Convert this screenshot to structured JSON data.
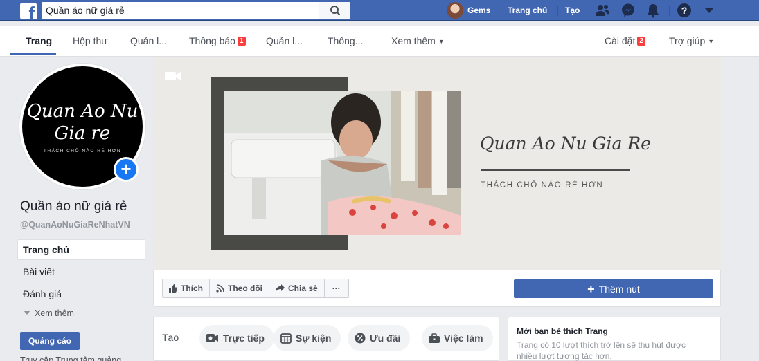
{
  "topbar": {
    "search_value": "Quần áo nữ giá rẻ",
    "user_name": "Gems",
    "home_link": "Trang chủ",
    "create_link": "Tạo",
    "logo_letter": "f"
  },
  "pagenav": {
    "items": [
      "Trang",
      "Hộp thư",
      "Quản l...",
      "Thông báo",
      "Quản l...",
      "Thông...",
      "Xem thêm"
    ],
    "notification_count": "1",
    "settings_label": "Cài đặt",
    "settings_count": "2",
    "help_label": "Trợ giúp"
  },
  "profile": {
    "script_line1": "Quan Ao Nu",
    "script_line2": "Gia re",
    "tagline": "THÁCH CHỖ NÀO RẺ HƠN",
    "name": "Quần áo nữ giá rẻ",
    "handle": "@QuanAoNuGiaReNhatVN"
  },
  "sidebar": {
    "items": [
      "Trang chủ",
      "Bài viết",
      "Đánh giá"
    ],
    "more": "Xem thêm",
    "ads_button": "Quảng cáo",
    "cut_text": "Truy cập Trung tâm quảng"
  },
  "cover": {
    "title": "Quan Ao Nu Gia Re",
    "subtitle": "THÁCH CHỖ NÀO RẺ HƠN"
  },
  "actions": {
    "like": "Thích",
    "follow": "Theo dõi",
    "share": "Chia sẻ",
    "more": "···",
    "add_button": "Thêm nút"
  },
  "create": {
    "label": "Tạo",
    "chips": [
      "Trực tiếp",
      "Sự kiện",
      "Ưu đãi",
      "Việc làm"
    ]
  },
  "invite": {
    "title": "Mời bạn bè thích Trang",
    "desc": "Trang có 10 lượt thích trở lên sẽ thu hút được nhiều lượt tương tác hơn."
  },
  "colors": {
    "brand": "#4267b2",
    "badge": "#fa3e3e",
    "add_photo": "#1877f2"
  }
}
